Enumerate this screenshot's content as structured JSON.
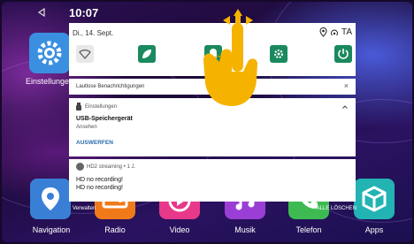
{
  "statusbar": {
    "time": "10:07"
  },
  "panel": {
    "date": "Di., 14. Sept.",
    "status_text": "TA",
    "quick_settings": [
      "battery-saver-tile",
      "bluetooth-tile",
      "gear-tile",
      "power-tile"
    ]
  },
  "notifications": {
    "silent": {
      "title": "Lautlose Benachrichtigungen",
      "dismiss": "×"
    },
    "usb": {
      "app": "Einstellungen",
      "title": "USB-Speichergerät",
      "subtitle": "Ansehen",
      "action": "AUSWERFEN"
    },
    "hd2": {
      "app_line": "HD2 streaming • 1 J.",
      "line1": "HD no recording!",
      "line2": "HD no recording!"
    },
    "footer": {
      "left": "Verwalten",
      "right": "ALLE LÖSCHEN"
    }
  },
  "apps": [
    {
      "label": "Navigation",
      "color": "#3a7fd6"
    },
    {
      "label": "Radio",
      "color": "#f07a1a"
    },
    {
      "label": "Video",
      "color": "#e8388a"
    },
    {
      "label": "Musik",
      "color": "#9b3ed6"
    },
    {
      "label": "Telefon",
      "color": "#3dbb52"
    },
    {
      "label": "Apps",
      "color": "#23b3b3"
    }
  ],
  "settings_app": {
    "label": "Einstellungen"
  }
}
